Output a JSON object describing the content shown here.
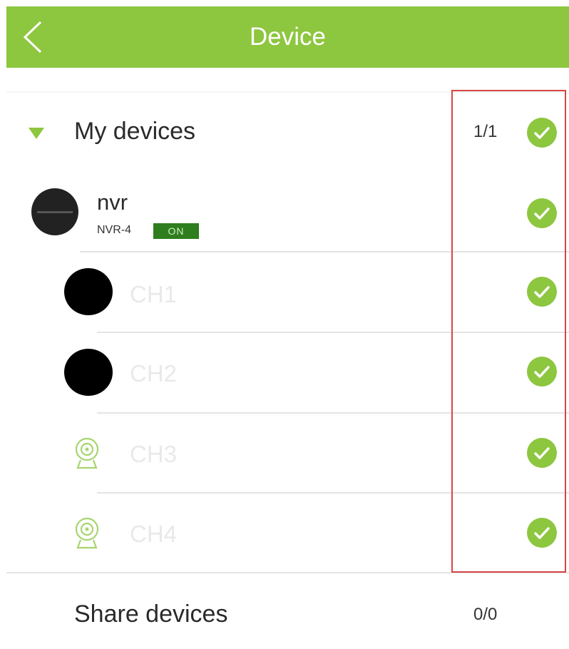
{
  "header": {
    "title": "Device",
    "back_icon": "chevron-left-icon"
  },
  "my_devices": {
    "label": "My devices",
    "count": "1/1",
    "expand_icon": "triangle-down-icon"
  },
  "nvr": {
    "name": "nvr",
    "model": "NVR-4",
    "status": "ON"
  },
  "channels": [
    {
      "label": "CH1",
      "icon": "redacted-thumbnail"
    },
    {
      "label": "CH2",
      "icon": "redacted-thumbnail"
    },
    {
      "label": "CH3",
      "icon": "webcam-icon"
    },
    {
      "label": "CH4",
      "icon": "webcam-icon"
    }
  ],
  "share_devices": {
    "label": "Share devices",
    "count": "0/0"
  },
  "colors": {
    "accent": "#8dc63f",
    "status_badge": "#2e7d1e",
    "highlight": "#d64545"
  }
}
